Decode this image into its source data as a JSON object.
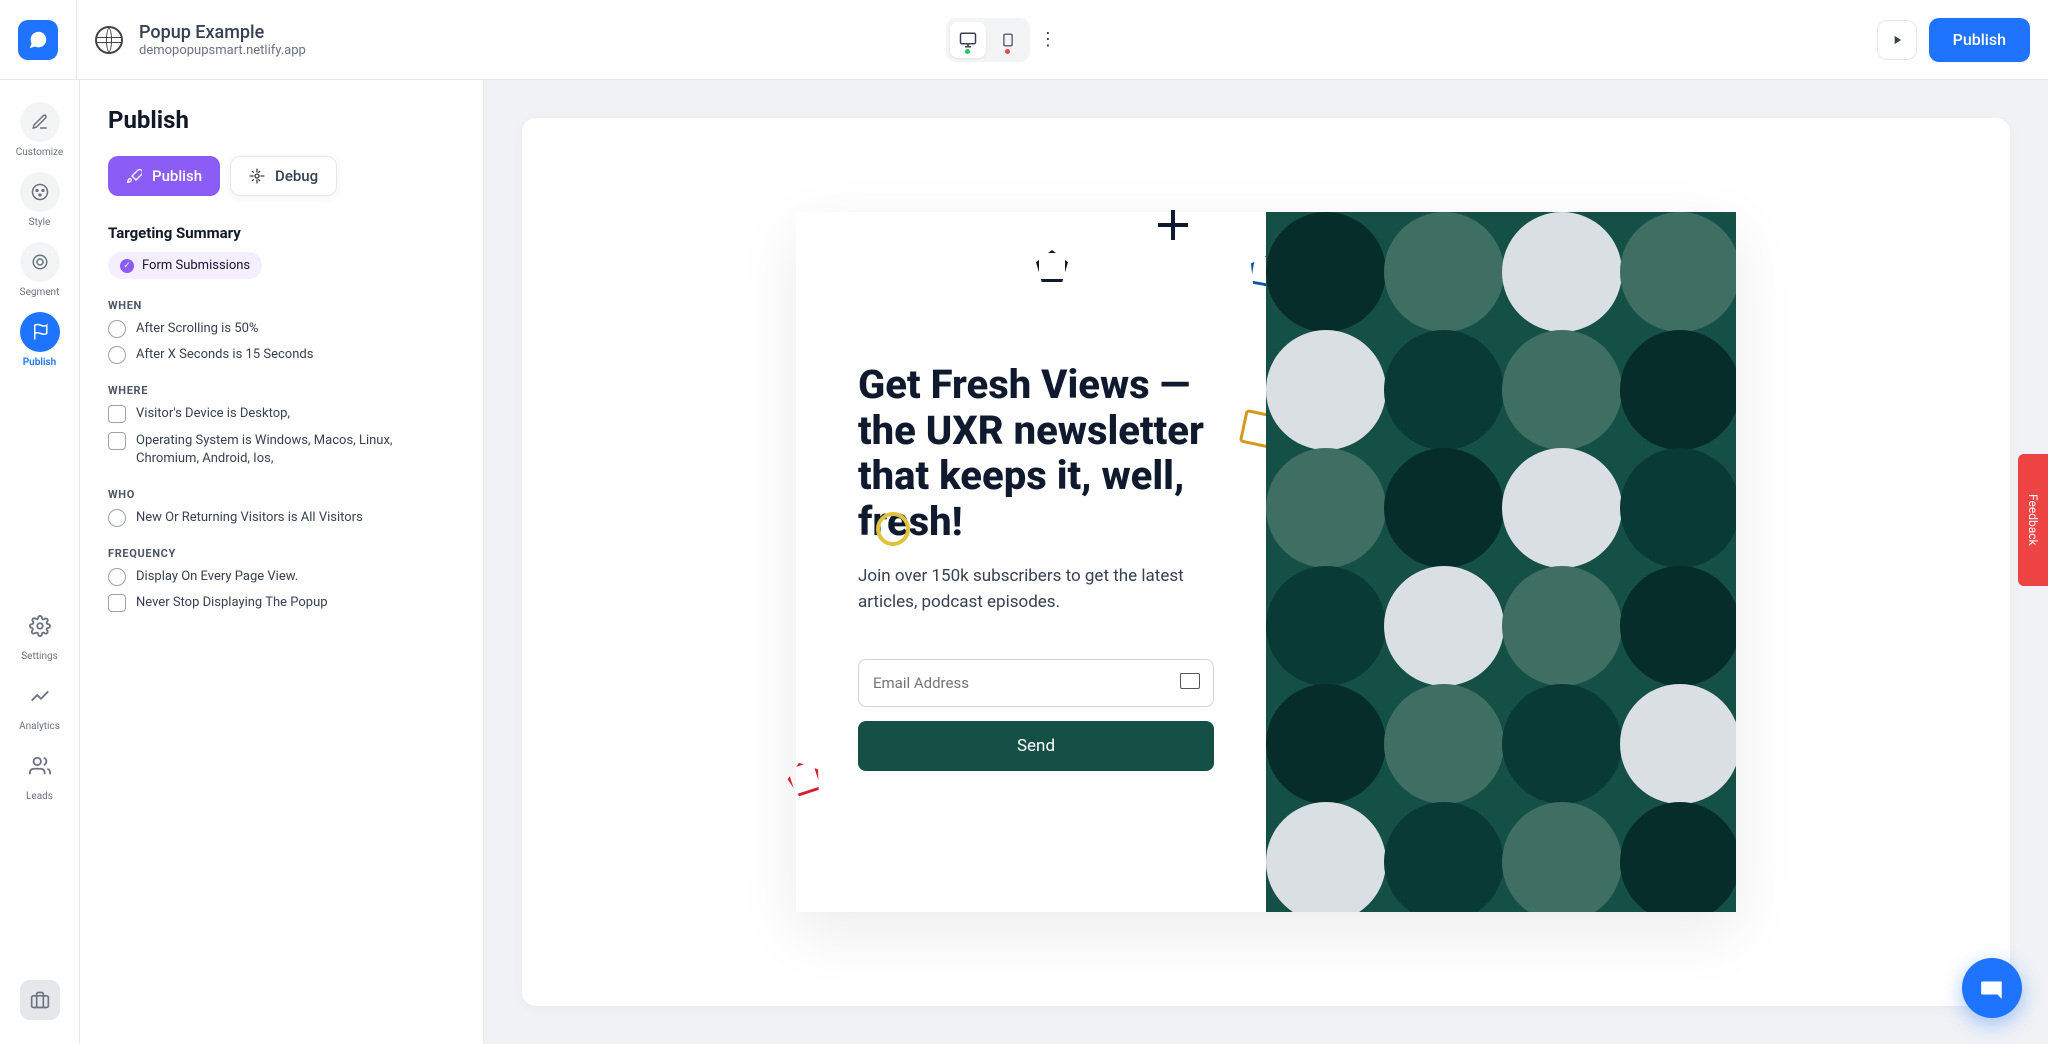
{
  "topbar": {
    "title": "Popup Example",
    "subtitle": "demopopupsmart.netlify.app",
    "publish_label": "Publish"
  },
  "rail": [
    {
      "id": "customize",
      "label": "Customize"
    },
    {
      "id": "style",
      "label": "Style"
    },
    {
      "id": "segment",
      "label": "Segment"
    },
    {
      "id": "publish",
      "label": "Publish"
    },
    {
      "id": "settings",
      "label": "Settings"
    },
    {
      "id": "analytics",
      "label": "Analytics"
    },
    {
      "id": "leads",
      "label": "Leads"
    }
  ],
  "sidebar": {
    "header": "Publish",
    "tab_publish": "Publish",
    "tab_debug": "Debug",
    "targeting_summary": "Targeting Summary",
    "chip_form_submissions": "Form Submissions",
    "sections": {
      "when": {
        "label": "WHEN",
        "rules": [
          "After Scrolling is 50%",
          "After X Seconds is 15 Seconds"
        ]
      },
      "where": {
        "label": "WHERE",
        "rules": [
          "Visitor's Device is Desktop,",
          "Operating System is Windows, Macos, Linux, Chromium, Android, Ios,"
        ]
      },
      "who": {
        "label": "WHO",
        "rules": [
          "New Or Returning Visitors is All Visitors"
        ]
      },
      "frequency": {
        "label": "FREQUENCY",
        "rules": [
          "Display On Every Page View.",
          "Never Stop Displaying The Popup"
        ]
      }
    }
  },
  "popup": {
    "heading": "Get Fresh Views — the UXR newsletter that keeps it, well, fresh!",
    "body": "Join over 150k subscribers to get the latest articles, podcast episodes.",
    "email_placeholder": "Email Address",
    "send_label": "Send"
  },
  "feedback_label": "Feedback",
  "colors": {
    "brand": "#1e74ff",
    "accent_purple": "#8b5cf6",
    "popup_accent": "#155047",
    "danger": "#ef4444"
  }
}
